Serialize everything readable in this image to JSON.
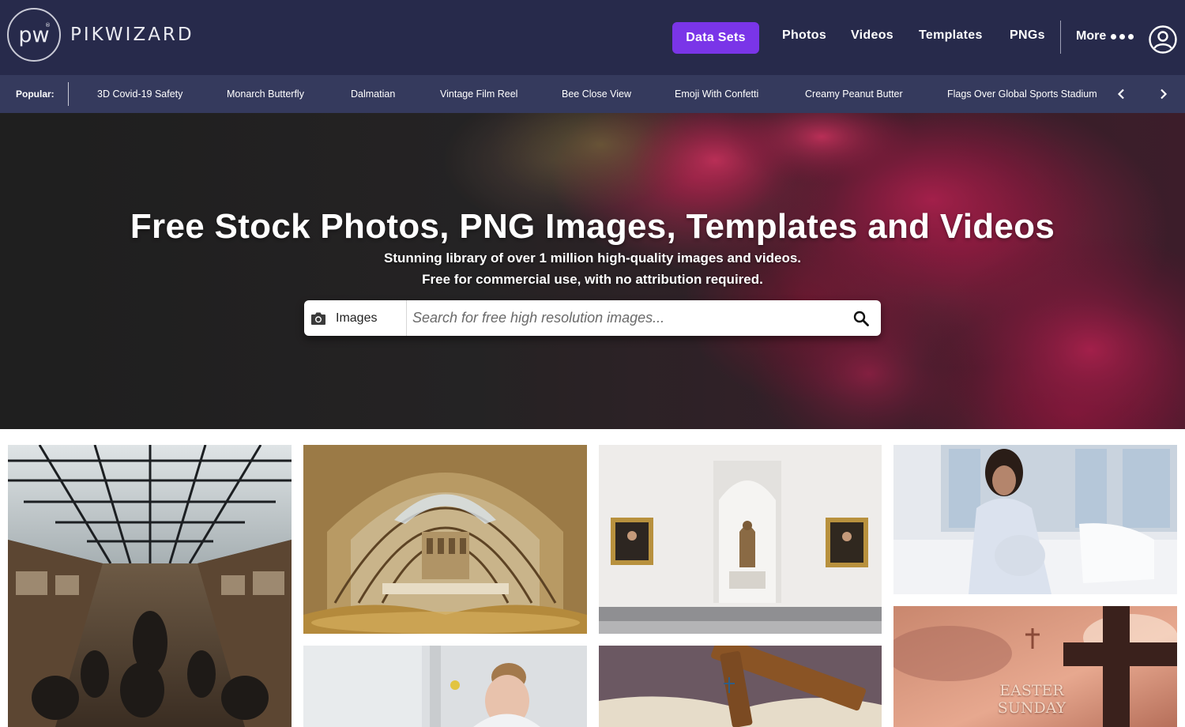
{
  "header": {
    "logo_mark": "pw",
    "logo_reg": "®",
    "logo_text": "PIKWIZARD",
    "nav": {
      "data_sets": "Data Sets",
      "photos": "Photos",
      "videos": "Videos",
      "templates": "Templates",
      "pngs": "PNGs",
      "more": "More"
    },
    "accent_color": "#7a35e8",
    "bg_color": "#272a4b"
  },
  "popular": {
    "label": "Popular:",
    "items": [
      "3D Covid-19 Safety",
      "Monarch Butterfly",
      "Dalmatian",
      "Vintage Film Reel",
      "Bee Close View",
      "Emoji With Confetti",
      "Creamy Peanut Butter",
      "Flags Over Global Sports Stadium"
    ],
    "icons": [
      "chevron-left-icon",
      "chevron-right-icon"
    ]
  },
  "hero": {
    "title": "Free Stock Photos, PNG Images, Templates and Videos",
    "subtitle_line1": "Stunning library of over 1 million high-quality images and videos.",
    "subtitle_line2": "Free for commercial use, with no attribution required."
  },
  "search": {
    "type_label": "Images",
    "placeholder": "Search for free high resolution images...",
    "icons": [
      "camera-icon",
      "search-icon"
    ]
  },
  "gallery": {
    "tile_1": "museum-hall-skeletons",
    "tile_2": "natural-history-museum-arches",
    "tile_3": "gallery-paintings-statue",
    "tile_4": "pregnant-woman-hospital",
    "tile_5": "woman-hospital-room",
    "tile_6": "wooden-cross-bible",
    "tile_7_text_line1": "EASTER",
    "tile_7_text_line2": "SUNDAY"
  }
}
